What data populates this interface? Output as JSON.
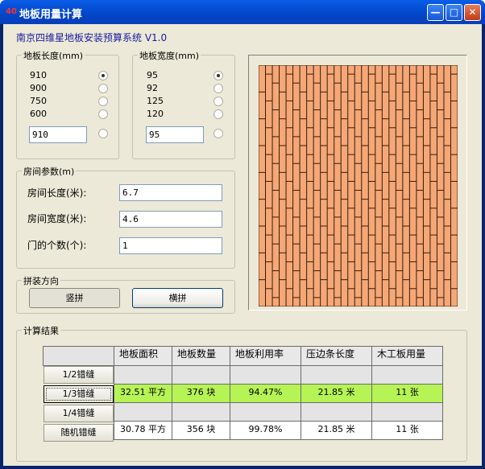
{
  "window": {
    "icon_text": "40",
    "title": "地板用量计算",
    "minimize_glyph": "—",
    "maximize_glyph": "□",
    "close_glyph": "✕"
  },
  "header": {
    "text": "南京四维星地板安装预算系统 V1.0"
  },
  "length_group": {
    "title": "地板长度(mm)",
    "options": [
      "910",
      "900",
      "750",
      "600"
    ],
    "selected_index": 0,
    "custom_value": "910"
  },
  "width_group": {
    "title": "地板宽度(mm)",
    "options": [
      "95",
      "92",
      "125",
      "120"
    ],
    "selected_index": 0,
    "custom_value": "95"
  },
  "room_group": {
    "title": "房间参数(m)",
    "length_label": "房间长度(米):",
    "length_value": "6.7",
    "width_label": "房间宽度(米):",
    "width_value": "4.6",
    "doors_label": "门的个数(个):",
    "doors_value": "1"
  },
  "layout_group": {
    "title": "拼装方向",
    "vertical_label": "竖拼",
    "horizontal_label": "横拼",
    "selected": "vertical"
  },
  "preview": {
    "board_color": "#f4a877",
    "line_color": "#3a1a08"
  },
  "results": {
    "title": "计算结果",
    "columns": [
      "地板面积",
      "地板数量",
      "地板利用率",
      "压边条长度",
      "木工板用量"
    ],
    "rows": [
      {
        "label": "1/2错缝",
        "cells": [
          "",
          "",
          "",
          "",
          ""
        ],
        "highlight": false
      },
      {
        "label": "1/3错缝",
        "cells": [
          "32.51 平方",
          "376 块",
          "94.47%",
          "21.85 米",
          "11 张"
        ],
        "highlight": true
      },
      {
        "label": "1/4错缝",
        "cells": [
          "",
          "",
          "",
          "",
          ""
        ],
        "highlight": false
      },
      {
        "label": "随机错缝",
        "cells": [
          "30.78 平方",
          "356 块",
          "99.78%",
          "21.85 米",
          "11 张"
        ],
        "highlight": false
      }
    ],
    "highlight_color": "#b6f456"
  }
}
